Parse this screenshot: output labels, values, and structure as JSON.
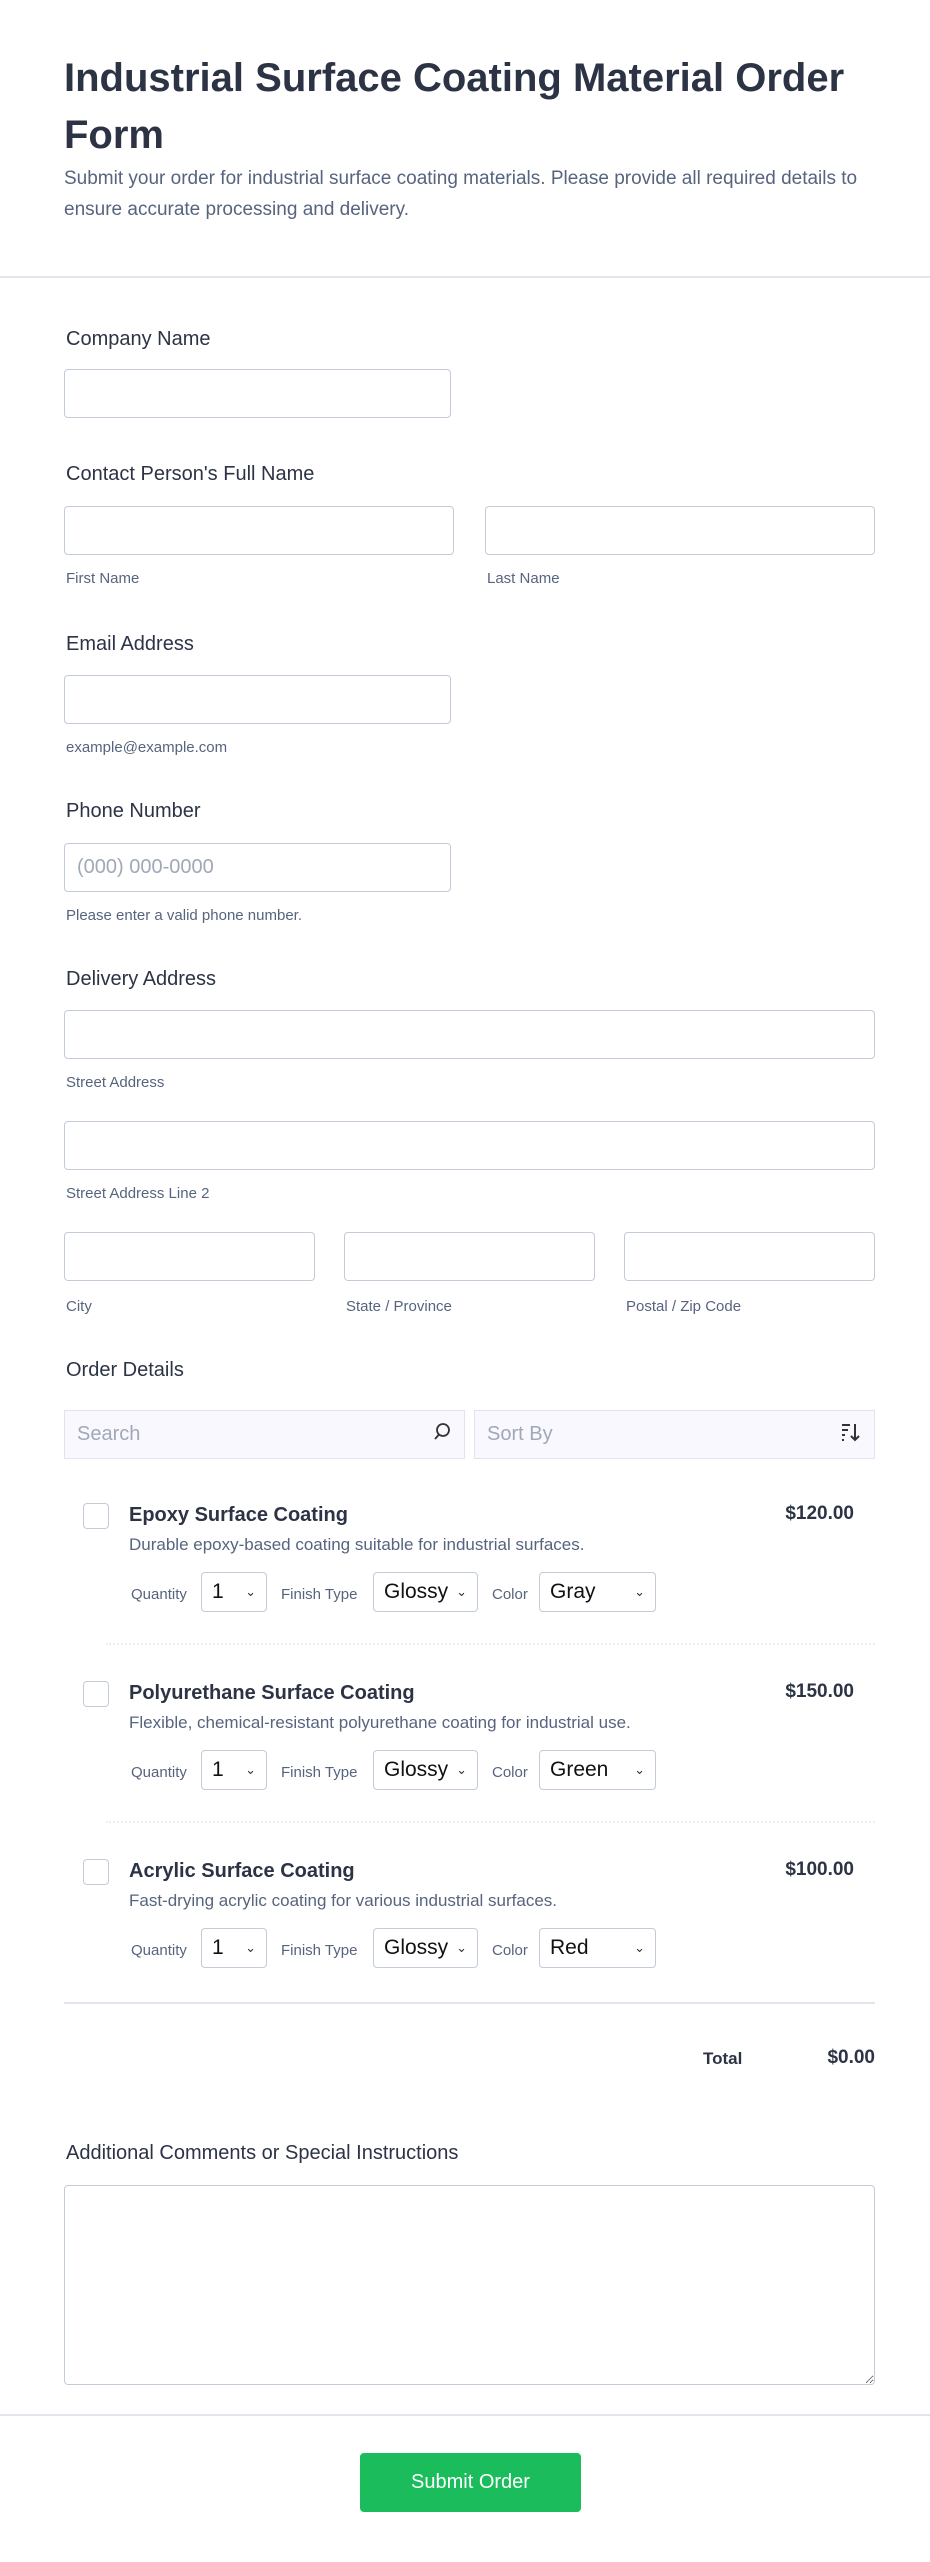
{
  "header": {
    "title": "Industrial Surface Coating Material Order Form",
    "description": "Submit your order for industrial surface coating materials. Please provide all required details to ensure accurate processing and delivery."
  },
  "company": {
    "label": "Company Name",
    "value": ""
  },
  "contact": {
    "label": "Contact Person's Full Name",
    "first_sublabel": "First Name",
    "last_sublabel": "Last Name"
  },
  "email": {
    "label": "Email Address",
    "sublabel": "example@example.com"
  },
  "phone": {
    "label": "Phone Number",
    "placeholder": "(000) 000-0000",
    "sublabel": "Please enter a valid phone number."
  },
  "address": {
    "label": "Delivery Address",
    "street": "Street Address",
    "street2": "Street Address Line 2",
    "city": "City",
    "state": "State / Province",
    "zip": "Postal / Zip Code"
  },
  "order": {
    "label": "Order Details",
    "search_placeholder": "Search",
    "sort_label": "Sort By",
    "option_labels": {
      "quantity": "Quantity",
      "finish": "Finish Type",
      "color": "Color"
    },
    "products": [
      {
        "name": "Epoxy Surface Coating",
        "description": "Durable epoxy-based coating suitable for industrial surfaces.",
        "price": "$120.00",
        "quantity": "1",
        "finish": "Glossy",
        "color": "Gray"
      },
      {
        "name": "Polyurethane Surface Coating",
        "description": "Flexible, chemical-resistant polyurethane coating for industrial use.",
        "price": "$150.00",
        "quantity": "1",
        "finish": "Glossy",
        "color": "Green"
      },
      {
        "name": "Acrylic Surface Coating",
        "description": "Fast-drying acrylic coating for various industrial surfaces.",
        "price": "$100.00",
        "quantity": "1",
        "finish": "Glossy",
        "color": "Red"
      }
    ],
    "total_label": "Total",
    "total_value": "$0.00"
  },
  "comments": {
    "label": "Additional Comments or Special Instructions"
  },
  "submit": {
    "label": "Submit Order"
  },
  "colors": {
    "accent": "#1abc5c",
    "text": "#2c3345",
    "muted": "#57647e"
  }
}
